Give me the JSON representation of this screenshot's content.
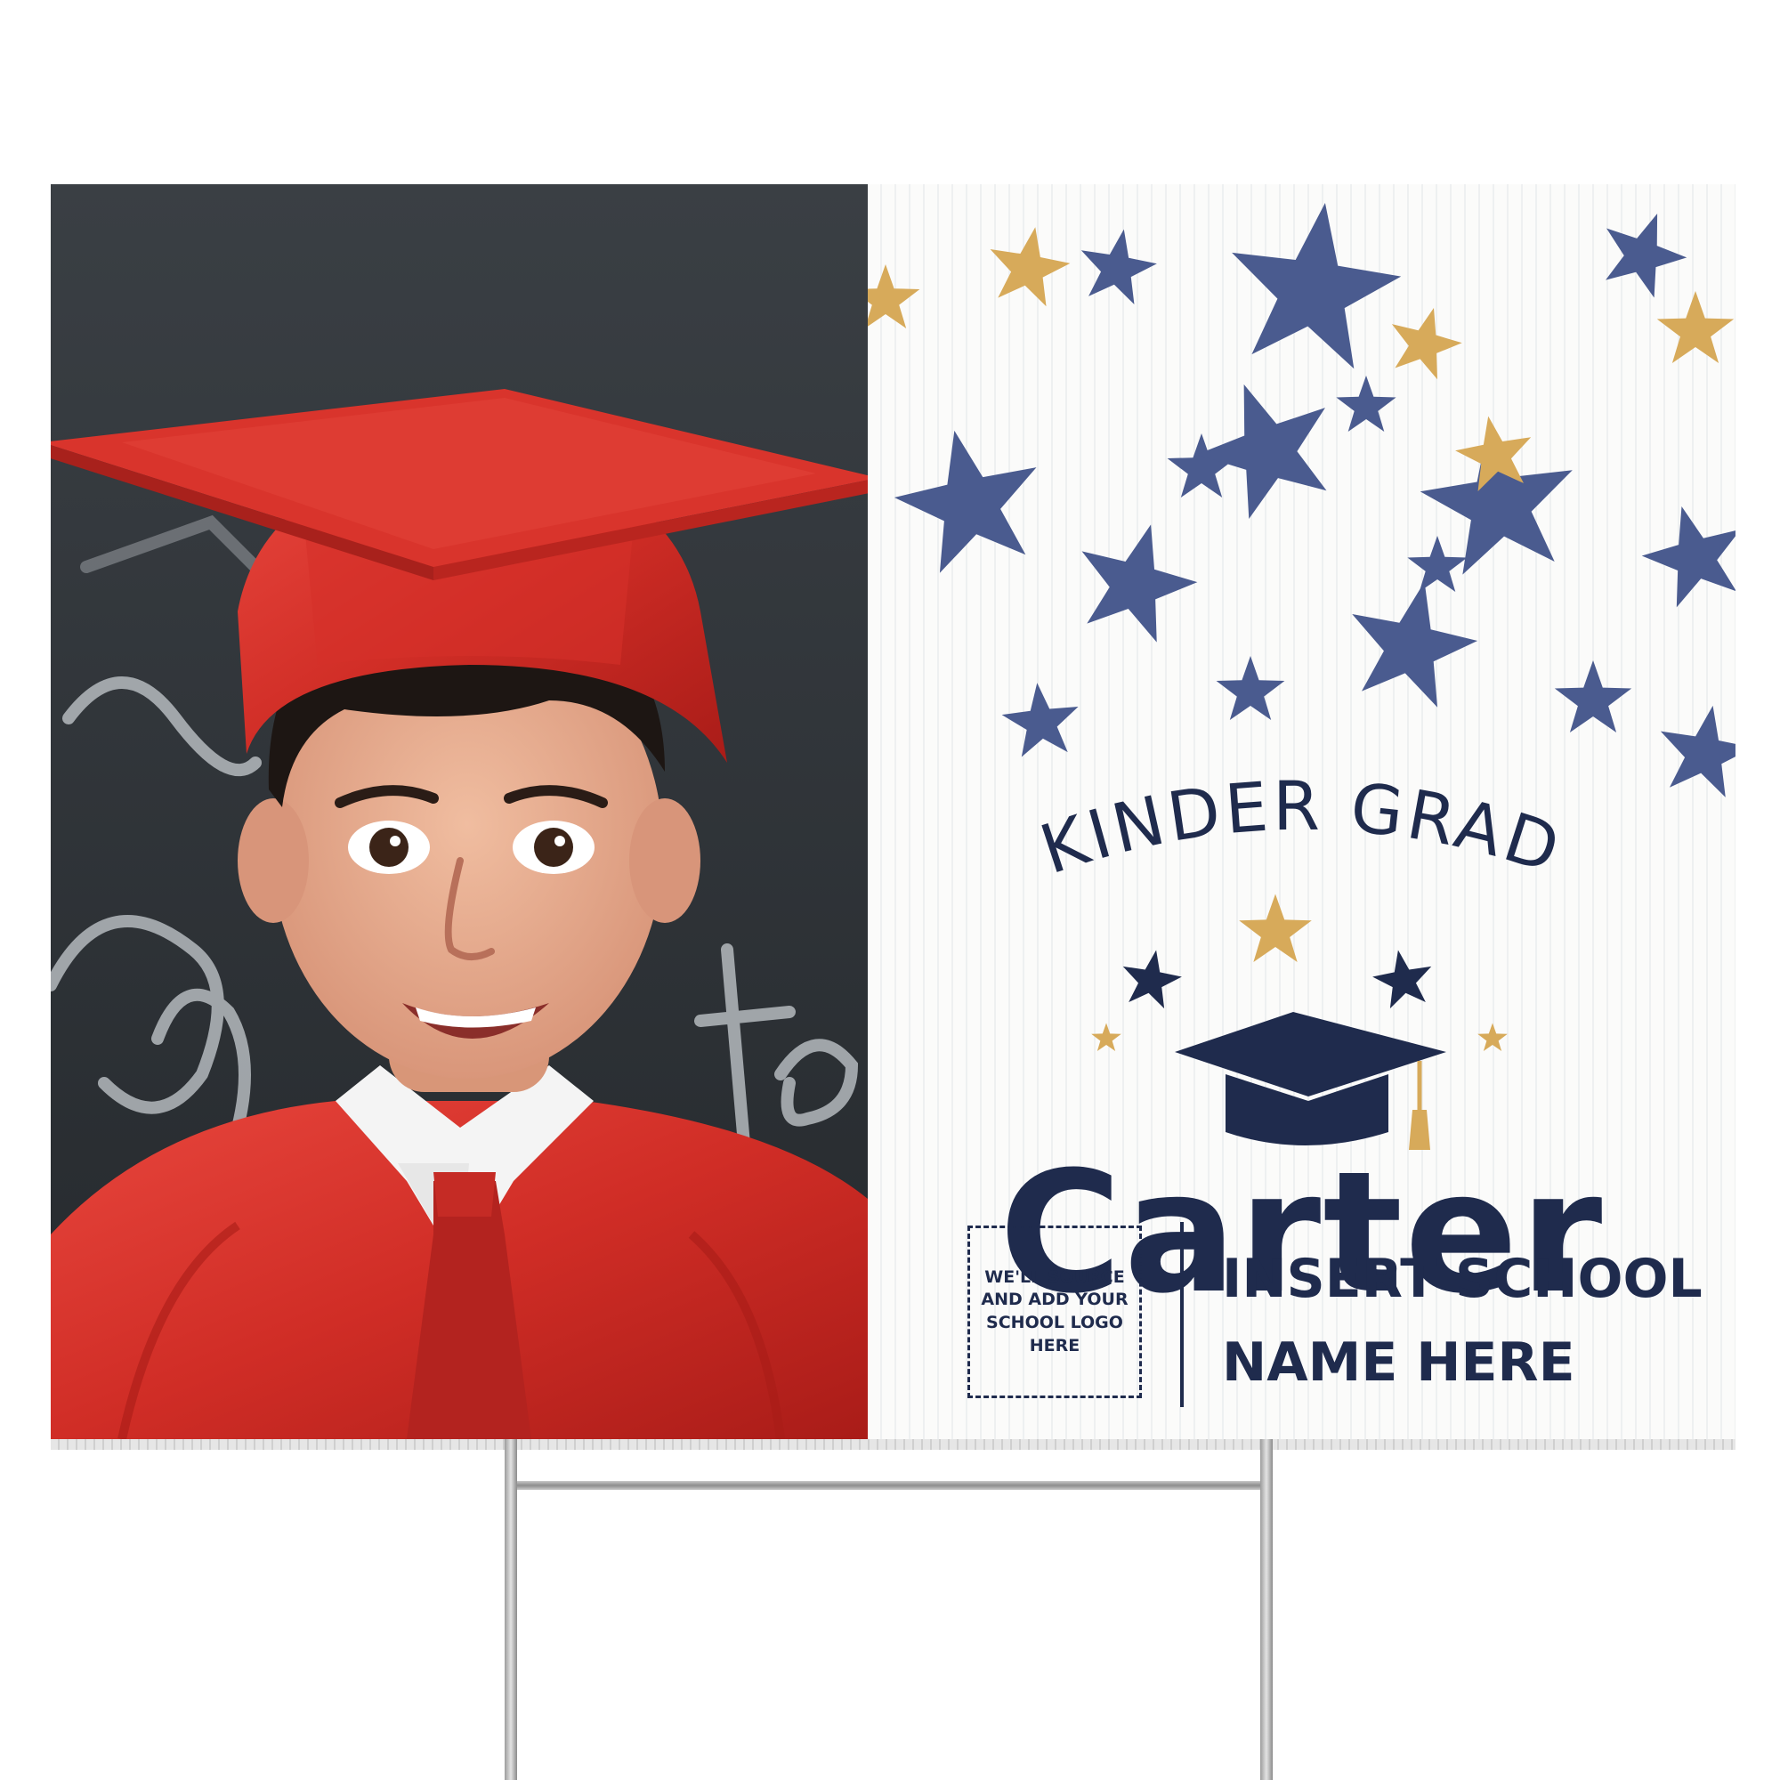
{
  "sign": {
    "headline": "KINDER GRAD",
    "name": "Carter",
    "logo_placeholder": "WE'LL SOURCE AND ADD YOUR SCHOOL LOGO HERE",
    "school_line_1": "INSERT SCHOOL",
    "school_line_2": "NAME HERE"
  },
  "colors": {
    "navy": "#1f2b4d",
    "star_blue": "#4a5b8f",
    "gold": "#d7aa5a",
    "gown_red": "#d8342d"
  },
  "icons": [
    "graduation-cap-icon",
    "star-icon"
  ]
}
